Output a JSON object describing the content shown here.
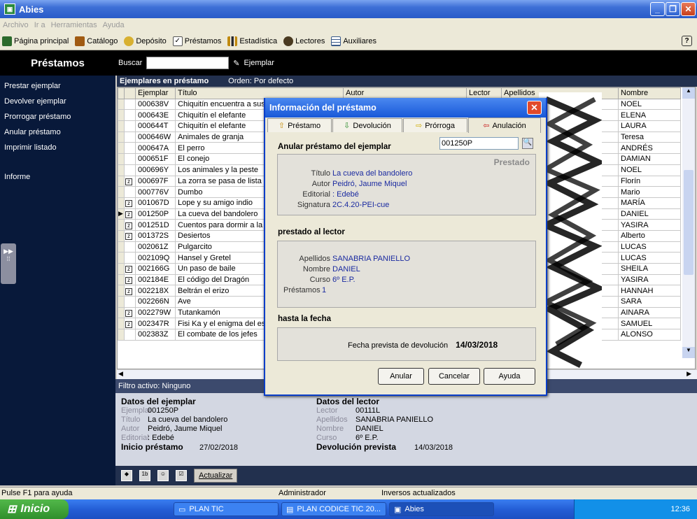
{
  "window": {
    "title": "Abies"
  },
  "menu": [
    "Archivo",
    "Ir a",
    "Herramientas",
    "Ayuda"
  ],
  "toolbar": [
    {
      "label": "Página principal",
      "icon": "house-icon",
      "color": "#2c6a2c"
    },
    {
      "label": "Catálogo",
      "icon": "book-icon",
      "color": "#a05a12"
    },
    {
      "label": "Depósito",
      "icon": "folder-icon",
      "color": "#d8b030"
    },
    {
      "label": "Préstamos",
      "icon": "checkbox-icon",
      "color": "#5a5a5a"
    },
    {
      "label": "Estadística",
      "icon": "bar-chart-icon",
      "color": "#c08a10"
    },
    {
      "label": "Lectores",
      "icon": "people-icon",
      "color": "#4a3a20"
    },
    {
      "label": "Auxiliares",
      "icon": "table-icon",
      "color": "#3a5a8a"
    }
  ],
  "sidebar": {
    "title": "Préstamos",
    "items": [
      "Prestar ejemplar",
      "Devolver ejemplar",
      "Prorrogar préstamo",
      "Anular préstamo",
      "Imprimir listado",
      "Informe"
    ]
  },
  "search": {
    "label": "Buscar",
    "placeholder": "",
    "field_label": "Ejemplar"
  },
  "grid": {
    "title": "Ejemplares en préstamo",
    "order": "Orden: Por defecto",
    "columns": [
      "Ejemplar",
      "Título",
      "Autor",
      "Lector",
      "Apellidos",
      "Nombre"
    ],
    "rows": [
      {
        "chk": false,
        "ej": "000638V",
        "tit": "Chiquitín encuentra a sus p",
        "nom": "NOEL"
      },
      {
        "chk": false,
        "ej": "000643E",
        "tit": "Chiquitín el elefante",
        "nom": "ELENA"
      },
      {
        "chk": false,
        "ej": "000644T",
        "tit": "Chiquitín el elefante",
        "nom": "LAURA"
      },
      {
        "chk": false,
        "ej": "000646W",
        "tit": "Animales de granja",
        "nom": "Teresa"
      },
      {
        "chk": false,
        "ej": "000647A",
        "tit": "El perro",
        "nom": "ANDRÉS"
      },
      {
        "chk": false,
        "ej": "000651F",
        "tit": "El conejo",
        "nom": "DAMIAN"
      },
      {
        "chk": false,
        "ej": "000696Y",
        "tit": "Los animales y la peste",
        "nom": "NOEL"
      },
      {
        "chk": true,
        "ej": "000697F",
        "tit": "La zorra se pasa de lista",
        "nom": "Florín"
      },
      {
        "chk": false,
        "ej": "000776V",
        "tit": "Dumbo",
        "nom": "Mario"
      },
      {
        "chk": true,
        "ej": "001067D",
        "tit": "Lope y su amigo indio",
        "nom": "MARÍA"
      },
      {
        "chk": true,
        "ej": "001250P",
        "tit": "La cueva del bandolero",
        "nom": "DANIEL",
        "current": true
      },
      {
        "chk": true,
        "ej": "001251D",
        "tit": "Cuentos para dormir a la ab",
        "nom": "YASIRA"
      },
      {
        "chk": true,
        "ej": "001372S",
        "tit": "Desiertos",
        "nom": "Alberto"
      },
      {
        "chk": false,
        "ej": "002061Z",
        "tit": "Pulgarcito",
        "nom": "LUCAS"
      },
      {
        "chk": false,
        "ej": "002109Q",
        "tit": "Hansel y Gretel",
        "nom": "LUCAS"
      },
      {
        "chk": true,
        "ej": "002166G",
        "tit": "Un paso de baile",
        "nom": "SHEILA"
      },
      {
        "chk": true,
        "ej": "002184E",
        "tit": "El código del Dragón",
        "nom": "YASIRA"
      },
      {
        "chk": true,
        "ej": "002218X",
        "tit": "Beltrán el erizo",
        "nom": "HANNAH"
      },
      {
        "chk": false,
        "ej": "002266N",
        "tit": "Ave",
        "nom": "SARA"
      },
      {
        "chk": true,
        "ej": "002279W",
        "tit": "Tutankamón",
        "nom": "AINARA"
      },
      {
        "chk": true,
        "ej": "002347R",
        "tit": "Fisi Ka y el enigma del espe",
        "nom": "SAMUEL"
      },
      {
        "chk": false,
        "ej": "002383Z",
        "tit": "El combate de los jefes",
        "nom": "ALONSO"
      }
    ]
  },
  "filter": "Filtro activo: Ninguno",
  "details": {
    "ejemplar_title": "Datos del ejemplar",
    "ejemplar_label": "Ejemplar",
    "ejemplar": "001250P",
    "titulo_label": "Título",
    "titulo": "La cueva del bandolero",
    "autor_label": "Autor",
    "autor": "Peidró, Jaume Miquel",
    "editorial_label": "Editorial",
    "editorial": ": Edebé",
    "inicio_label": "Inicio préstamo",
    "inicio": "27/02/2018",
    "lector_title": "Datos del lector",
    "lector_label": "Lector",
    "lector": "00111L",
    "apellidos_label": "Apellidos",
    "apellidos": "SANABRIA PANIELLO",
    "nombre_label": "Nombre",
    "nombre": "DANIEL",
    "curso_label": "Curso",
    "curso": "6º E.P.",
    "devolucion_label": "Devolución prevista",
    "devolucion": "14/03/2018",
    "refresh": "Actualizar"
  },
  "dialog": {
    "title": "Información del préstamo",
    "tabs": [
      "Préstamo",
      "Devolución",
      "Prórroga",
      "Anulación"
    ],
    "heading": "Anular préstamo del ejemplar",
    "code": "001250P",
    "state": "Prestado",
    "titulo_label": "Título",
    "titulo": "La cueva del bandolero",
    "autor_label": "Autor",
    "autor": "Peidró, Jaume Miquel",
    "editorial_label": "Editorial",
    "editorial": ": Edebé",
    "signatura_label": "Signatura",
    "signatura": "2C.4.20-PEI-cue",
    "lector_heading": "prestado al lector",
    "apellidos_label": "Apellidos",
    "apellidos": "SANABRIA PANIELLO",
    "nombre_label": "Nombre",
    "nombre": "DANIEL",
    "curso_label": "Curso",
    "curso": "6º E.P.",
    "prestamos_label": "Préstamos",
    "prestamos": "1",
    "fecha_heading": "hasta la fecha",
    "fecha_label": "Fecha prevista de devolución",
    "fecha": "14/03/2018",
    "btn_anular": "Anular",
    "btn_cancelar": "Cancelar",
    "btn_ayuda": "Ayuda"
  },
  "status": {
    "help": "Pulse F1 para ayuda",
    "user": "Administrador",
    "info": "Inversos actualizados"
  },
  "taskbar": {
    "start": "Inicio",
    "tasks": [
      "PLAN TIC",
      "PLAN CODICE TIC 20...",
      "Abies"
    ],
    "clock": "12:36"
  }
}
